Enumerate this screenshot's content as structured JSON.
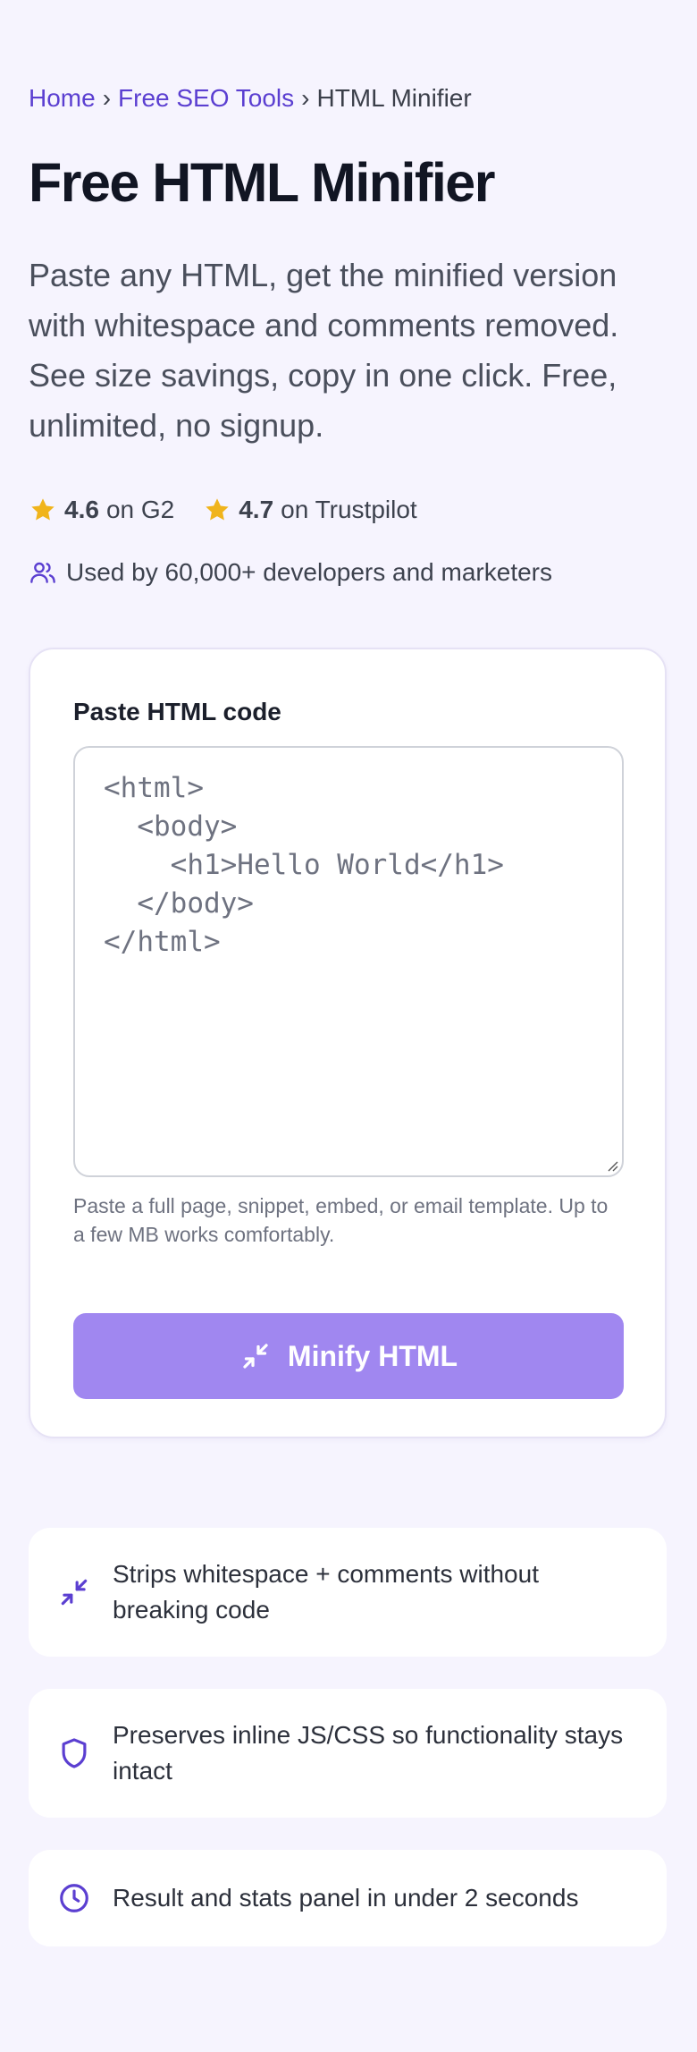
{
  "breadcrumb": {
    "home": "Home",
    "sep1": "›",
    "tools": "Free SEO Tools",
    "sep2": "›",
    "current": "HTML Minifier"
  },
  "page": {
    "title": "Free HTML Minifier",
    "subtitle": "Paste any HTML, get the minified version with whitespace and comments removed. See size savings, copy in one click. Free, unlimited, no signup."
  },
  "ratings": [
    {
      "score": "4.6",
      "label": "on G2",
      "icon": "star-icon"
    },
    {
      "score": "4.7",
      "label": "on Trustpilot",
      "icon": "star-icon"
    }
  ],
  "social_proof": {
    "icon": "users-icon",
    "text": "Used by 60,000+ developers and marketers"
  },
  "form": {
    "label": "Paste HTML code",
    "placeholder": "<html>\n  <body>\n    <h1>Hello World</h1>\n  </body>\n</html>",
    "help": "Paste a full page, snippet, embed, or email template. Up to a few MB works comfortably.",
    "button_label": "Minify HTML",
    "button_icon": "minimize-arrows-icon"
  },
  "features": [
    {
      "icon": "minimize-arrows-icon",
      "text": "Strips whitespace + comments without breaking code"
    },
    {
      "icon": "shield-icon",
      "text": "Preserves inline JS/CSS so functionality stays intact"
    },
    {
      "icon": "clock-icon",
      "text": "Result and stats panel in under 2 seconds"
    }
  ],
  "colors": {
    "background": "#f6f4fe",
    "accent": "#5b3fd1",
    "button": "#a087f0",
    "star": "#f0b41c"
  }
}
